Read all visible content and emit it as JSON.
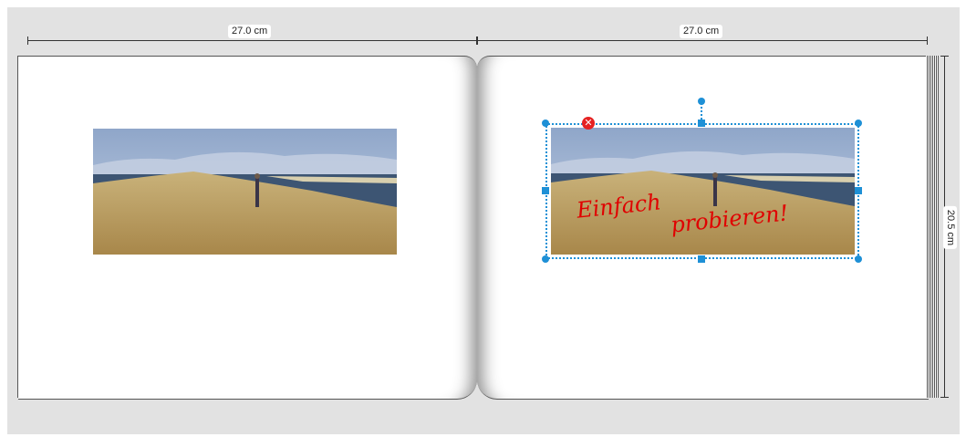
{
  "dimensions": {
    "left_width": "27.0 cm",
    "right_width": "27.0 cm",
    "height": "20.5 cm"
  },
  "handwriting": {
    "word1": "Einfach",
    "word2": "probieren!"
  },
  "colors": {
    "selection": "#1e90d6",
    "delete": "#e52222",
    "handwriting": "#e00000"
  },
  "icons": {
    "delete": "close-circle-icon"
  }
}
